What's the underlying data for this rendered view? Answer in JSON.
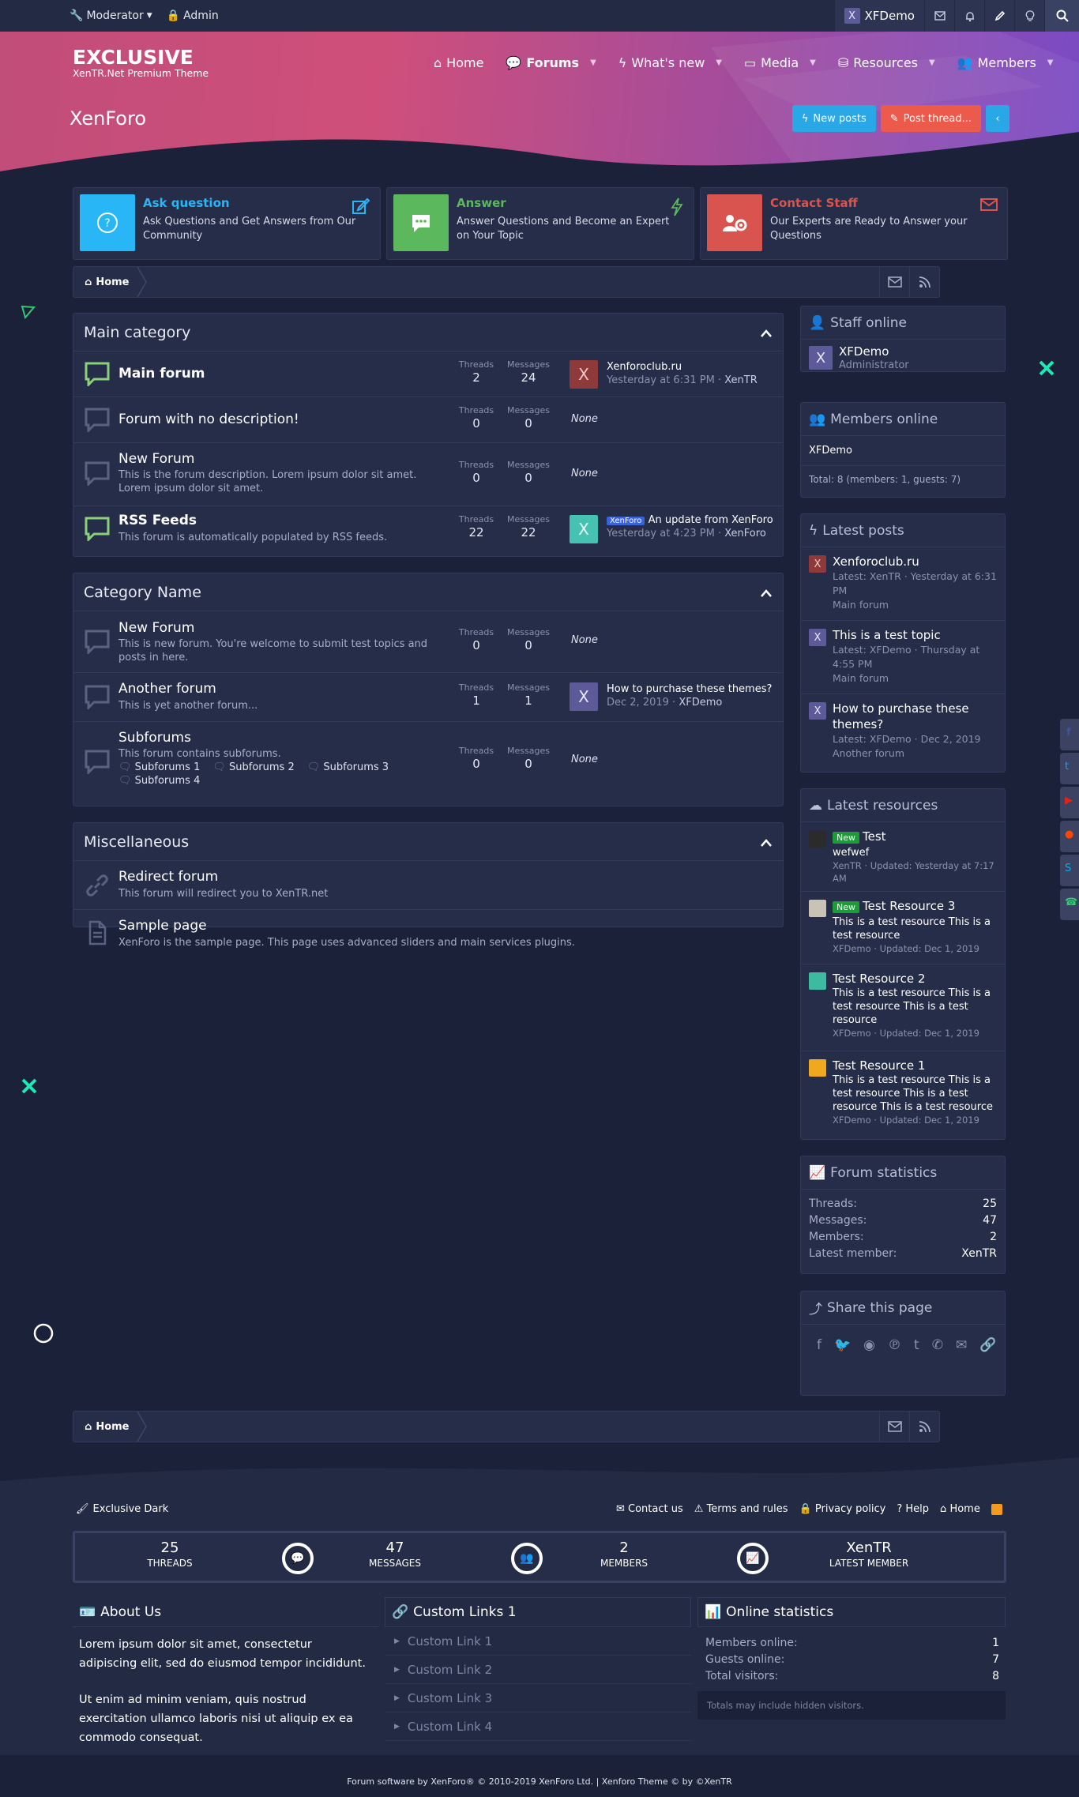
{
  "topbar": {
    "moderator": "Moderator",
    "admin": "Admin",
    "user": "XFDemo",
    "user_initial": "X"
  },
  "brand": {
    "logo": "EXCLUSIVE",
    "tagline": "XenTR.Net Premium Theme"
  },
  "nav": [
    {
      "label": "Home",
      "icon": "home-icon"
    },
    {
      "label": "Forums",
      "icon": "comments-icon"
    },
    {
      "label": "What's new",
      "icon": "bolt-icon"
    },
    {
      "label": "Media",
      "icon": "video-icon"
    },
    {
      "label": "Resources",
      "icon": "box-icon"
    },
    {
      "label": "Members",
      "icon": "users-icon"
    }
  ],
  "page": {
    "title": "XenForo",
    "new_posts": "New posts",
    "post_thread": "Post thread..."
  },
  "features": [
    {
      "title": "Ask question",
      "desc": "Ask Questions and Get Answers from Our Community",
      "color": "#29b6f6"
    },
    {
      "title": "Answer",
      "desc": "Answer Questions and Become an Expert on Your Topic",
      "color": "#5cb85c"
    },
    {
      "title": "Contact Staff",
      "desc": "Our Experts are Ready to Answer your Questions",
      "color": "#d9534f"
    }
  ],
  "breadcrumb": {
    "home": "Home"
  },
  "stat_labels": {
    "threads": "Threads",
    "messages": "Messages",
    "none": "None"
  },
  "categories": [
    {
      "title": "Main category",
      "forums": [
        {
          "title": "Main forum",
          "desc": "",
          "threads": "2",
          "messages": "24",
          "last_title": "Xenforoclub.ru",
          "last_meta": "Yesterday at 6:31 PM",
          "last_user": "XenTR",
          "avatar": "X"
        },
        {
          "title": "Forum with no description!",
          "desc": "",
          "threads": "0",
          "messages": "0"
        },
        {
          "title": "New Forum",
          "desc": "This is the forum description. Lorem ipsum dolor sit amet. Lorem ipsum dolor sit amet.",
          "threads": "0",
          "messages": "0"
        },
        {
          "title": "RSS Feeds",
          "desc": "This forum is automatically populated by RSS feeds.",
          "threads": "22",
          "messages": "22",
          "prefix": "XenForo",
          "last_title": "An update from XenForo",
          "last_meta": "Yesterday at 4:23 PM",
          "last_user": "XenForo",
          "avatar": "X"
        }
      ]
    },
    {
      "title": "Category Name",
      "forums": [
        {
          "title": "New Forum",
          "desc": "This is new forum. You're welcome to submit test topics and posts in here.",
          "threads": "0",
          "messages": "0"
        },
        {
          "title": "Another forum",
          "desc": "This is yet another forum...",
          "threads": "1",
          "messages": "1",
          "last_title": "How to purchase these themes?",
          "last_meta": "Dec 2, 2019",
          "last_user": "XFDemo",
          "avatar": "X"
        },
        {
          "title": "Subforums",
          "desc": "This forum contains subforums.",
          "threads": "0",
          "messages": "0",
          "subforums": [
            "Subforums 1",
            "Subforums 2",
            "Subforums 3",
            "Subforums 4"
          ]
        }
      ]
    },
    {
      "title": "Miscellaneous",
      "forums": [
        {
          "title": "Redirect forum",
          "desc": "This forum will redirect you to XenTR.net"
        },
        {
          "title": "Sample page",
          "desc": "XenForo is the sample page. This page uses advanced sliders and main services plugins."
        }
      ]
    }
  ],
  "sidebar": {
    "staff_title": "Staff online",
    "staff_name": "XFDemo",
    "staff_role": "Administrator",
    "members_title": "Members online",
    "members_name": "XFDemo",
    "members_total": "Total: 8 (members: 1, guests: 7)",
    "latest_posts_title": "Latest posts",
    "latest_posts": [
      {
        "title": "Xenforoclub.ru",
        "meta": "Latest: XenTR · Yesterday at 6:31 PM",
        "forum": "Main forum"
      },
      {
        "title": "This is a test topic",
        "meta": "Latest: XFDemo · Thursday at 4:55 PM",
        "forum": "Main forum"
      },
      {
        "title": "How to purchase these themes?",
        "meta": "Latest: XFDemo · Dec 2, 2019",
        "forum": "Another forum"
      }
    ],
    "resources_title": "Latest resources",
    "new_badge": "New",
    "resources": [
      {
        "title": "Test",
        "desc": "wefwef",
        "meta": "XenTR · Updated: Yesterday at 7:17 AM",
        "new": true
      },
      {
        "title": "Test Resource 3",
        "desc": "This is a test resource This is a test resource",
        "meta": "XFDemo · Updated: Dec 1, 2019",
        "new": true
      },
      {
        "title": "Test Resource 2",
        "desc": "This is a test resource This is a test resource This is a test resource",
        "meta": "XFDemo · Updated: Dec 1, 2019",
        "new": false
      },
      {
        "title": "Test Resource 1",
        "desc": "This is a test resource This is a test resource This is a test resource This is a test resource",
        "meta": "XFDemo · Updated: Dec 1, 2019",
        "new": false
      }
    ],
    "stats_title": "Forum statistics",
    "stats": [
      {
        "k": "Threads:",
        "v": "25"
      },
      {
        "k": "Messages:",
        "v": "47"
      },
      {
        "k": "Members:",
        "v": "2"
      },
      {
        "k": "Latest member:",
        "v": "XenTR"
      }
    ],
    "share_title": "Share this page"
  },
  "footer": {
    "style": "Exclusive Dark",
    "links": [
      "Contact us",
      "Terms and rules",
      "Privacy policy",
      "Help",
      "Home"
    ],
    "stats": [
      {
        "n": "25",
        "l": "THREADS"
      },
      {
        "n": "47",
        "l": "MESSAGES"
      },
      {
        "n": "2",
        "l": "MEMBERS"
      },
      {
        "n": "XenTR",
        "l": "LATEST MEMBER"
      }
    ],
    "about_title": "About Us",
    "about_p1": "Lorem ipsum dolor sit amet, consectetur adipiscing elit, sed do eiusmod tempor incididunt.",
    "about_p2": "Ut enim ad minim veniam, quis nostrud exercitation ullamco laboris nisi ut aliquip ex ea commodo consequat.",
    "links_title": "Custom Links 1",
    "custom_links": [
      "Custom Link 1",
      "Custom Link 2",
      "Custom Link 3",
      "Custom Link 4"
    ],
    "online_title": "Online statistics",
    "online": [
      {
        "k": "Members online:",
        "v": "1"
      },
      {
        "k": "Guests online:",
        "v": "7"
      },
      {
        "k": "Total visitors:",
        "v": "8"
      }
    ],
    "online_note": "Totals may include hidden visitors.",
    "copyright": "Forum software by XenForo® © 2010-2019 XenForo Ltd. | Xenforo Theme © by ©XenTR"
  },
  "colors": {
    "accent": "#2aa7e6",
    "hero_start": "#c14d79",
    "hero_end": "#7a4bc4",
    "bg": "#1b2138",
    "panel": "#262d48"
  }
}
